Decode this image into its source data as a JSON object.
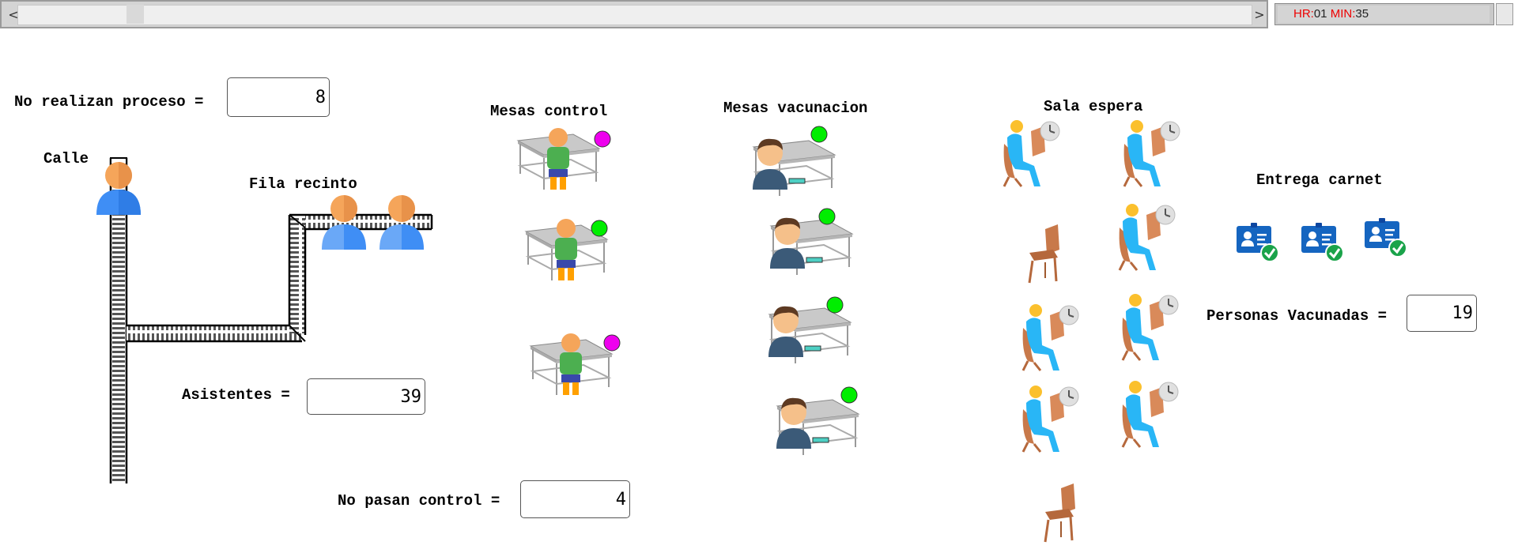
{
  "clock": {
    "hr_label": "HR:",
    "hr_value": "01",
    "min_label": "MIN:",
    "min_value": "35"
  },
  "scroll": {
    "left_arrow": "<",
    "right_arrow": ">"
  },
  "labels": {
    "no_realizan": "No realizan proceso =",
    "calle": "Calle",
    "fila_recinto": "Fila recinto",
    "asistentes": "Asistentes =",
    "no_pasan": "No pasan control =",
    "mesas_control": "Mesas control",
    "mesas_vacunacion": "Mesas vacunacion",
    "sala_espera": "Sala espera",
    "entrega_carnet": "Entrega carnet",
    "personas_vacunadas": "Personas Vacunadas ="
  },
  "values": {
    "no_realizan": "8",
    "asistentes": "39",
    "no_pasan": "4",
    "personas_vacunadas": "19"
  },
  "colors": {
    "status_green": "#00ee00",
    "status_magenta": "#ee00ee",
    "person_blue": "#3f8ef5",
    "person_skin": "#f5a55a",
    "chair_brown": "#c8794a",
    "patient_cyan": "#29b6f6",
    "carnet_blue": "#1565c0",
    "check_green": "#1aa34a"
  },
  "control_tables": [
    {
      "status": "magenta"
    },
    {
      "status": "green"
    },
    {
      "status": "magenta"
    }
  ],
  "vaccination_tables": [
    {
      "status": "green"
    },
    {
      "status": "green"
    },
    {
      "status": "green"
    },
    {
      "status": "green"
    }
  ],
  "waiting_seats": [
    {
      "occupied": true
    },
    {
      "occupied": true
    },
    {
      "occupied": false
    },
    {
      "occupied": true
    },
    {
      "occupied": true
    },
    {
      "occupied": true
    },
    {
      "occupied": true
    },
    {
      "occupied": true
    },
    {
      "occupied": false
    }
  ],
  "carnets": 3
}
